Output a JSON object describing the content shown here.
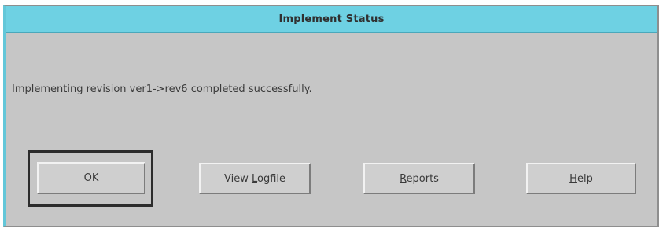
{
  "window": {
    "title": "Implement Status"
  },
  "message": "Implementing revision ver1->rev6 completed successfully.",
  "buttons": {
    "ok": {
      "label": "OK"
    },
    "view_logfile": {
      "prefix": "View ",
      "mnemonic": "L",
      "suffix": "ogfile"
    },
    "reports": {
      "prefix": "",
      "mnemonic": "R",
      "suffix": "eports"
    },
    "help": {
      "prefix": "",
      "mnemonic": "H",
      "suffix": "elp"
    }
  },
  "colors": {
    "titlebar": "#6ed1e3",
    "dialog_background": "#c6c6c6",
    "button_background": "#cfcfcf"
  }
}
